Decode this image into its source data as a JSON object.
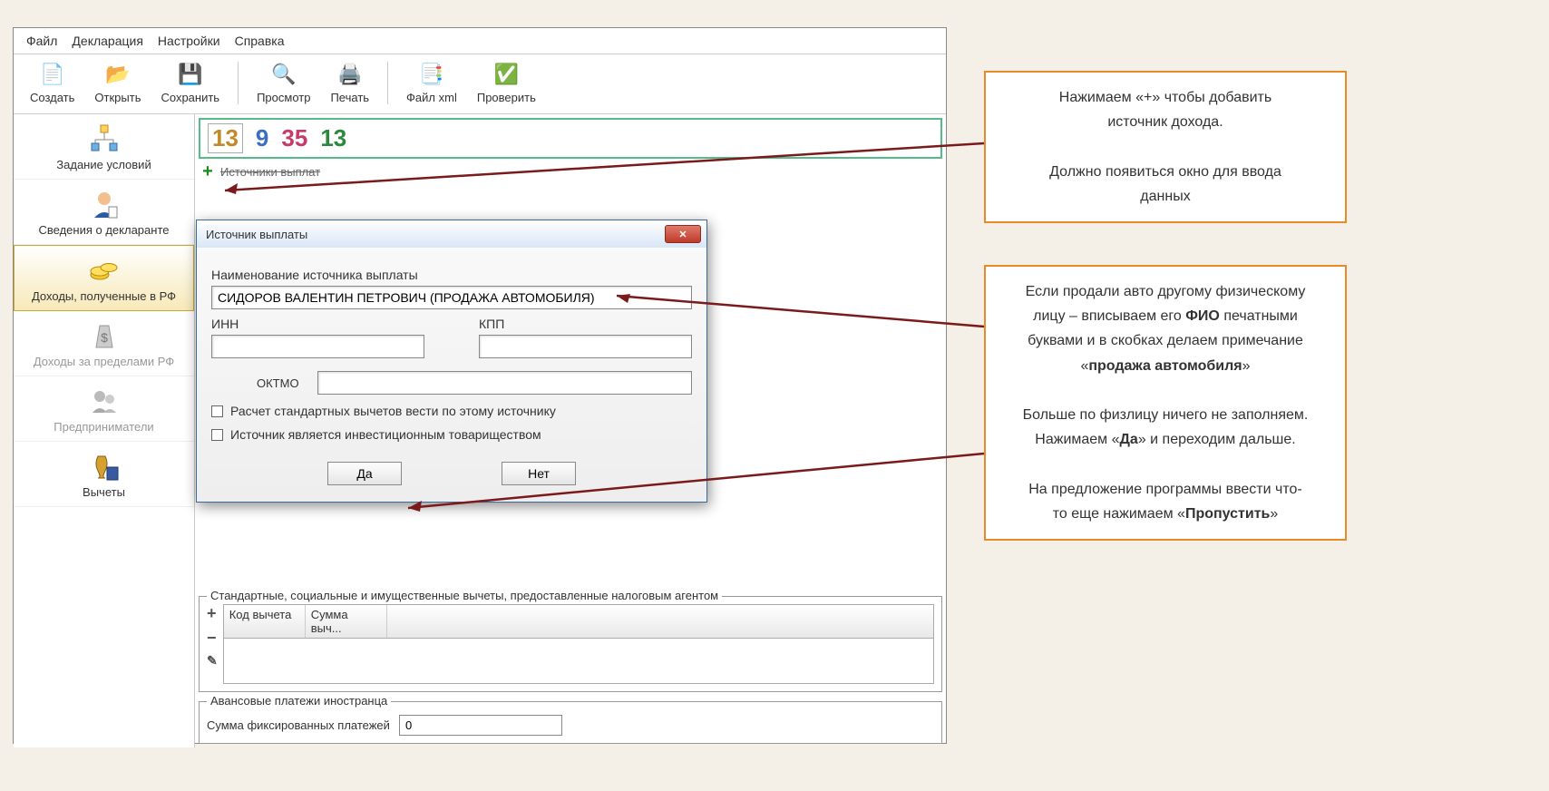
{
  "menu": {
    "file": "Файл",
    "declaration": "Декларация",
    "settings": "Настройки",
    "help": "Справка"
  },
  "toolbar": {
    "create": "Создать",
    "open": "Открыть",
    "save": "Сохранить",
    "preview": "Просмотр",
    "print": "Печать",
    "xml": "Файл xml",
    "check": "Проверить"
  },
  "sidebar": {
    "conditions": "Задание условий",
    "declarant": "Сведения о декларанте",
    "income_rf": "Доходы, полученные в РФ",
    "income_abroad": "Доходы за пределами РФ",
    "entrepreneurs": "Предприниматели",
    "deductions": "Вычеты"
  },
  "rates": {
    "r13a": "13",
    "r9": "9",
    "r35": "35",
    "r13b": "13"
  },
  "sources": {
    "header": "Источники выплат"
  },
  "deduct_group": {
    "title": "Стандартные, социальные и имущественные вычеты, предоставленные налоговым агентом",
    "col1": "Код вычета",
    "col2": "Сумма выч..."
  },
  "advance_group": {
    "title": "Авансовые платежи иностранца",
    "label": "Сумма фиксированных платежей",
    "value": "0"
  },
  "modal": {
    "title": "Источник выплаты",
    "name_label": "Наименование источника выплаты",
    "name_value": "СИДОРОВ ВАЛЕНТИН ПЕТРОВИЧ (ПРОДАЖА АВТОМОБИЛЯ)",
    "inn": "ИНН",
    "kpp": "КПП",
    "oktmo": "ОКТМО",
    "chk1": "Расчет стандартных вычетов вести по этому источнику",
    "chk2": "Источник является инвестиционным товариществом",
    "yes": "Да",
    "no": "Нет"
  },
  "annot1": {
    "l1": "Нажимаем «+» чтобы добавить",
    "l2": "источник дохода.",
    "l3": "Должно появиться окно для ввода",
    "l4": "данных"
  },
  "annot2": {
    "l1": "Если продали авто другому физическому",
    "l2_a": "лицу – вписываем его ",
    "l2_b": "ФИО",
    "l2_c": " печатными",
    "l3": "буквами и в скобках делаем примечание",
    "l4_a": "«",
    "l4_b": "продажа автомобиля",
    "l4_c": "»",
    "l5": "Больше по физлицу ничего не заполняем.",
    "l6_a": "Нажимаем «",
    "l6_b": "Да",
    "l6_c": "» и переходим дальше.",
    "l7": "На предложение программы ввести что-",
    "l8_a": "то еще нажимаем «",
    "l8_b": "Пропустить",
    "l8_c": "»"
  }
}
